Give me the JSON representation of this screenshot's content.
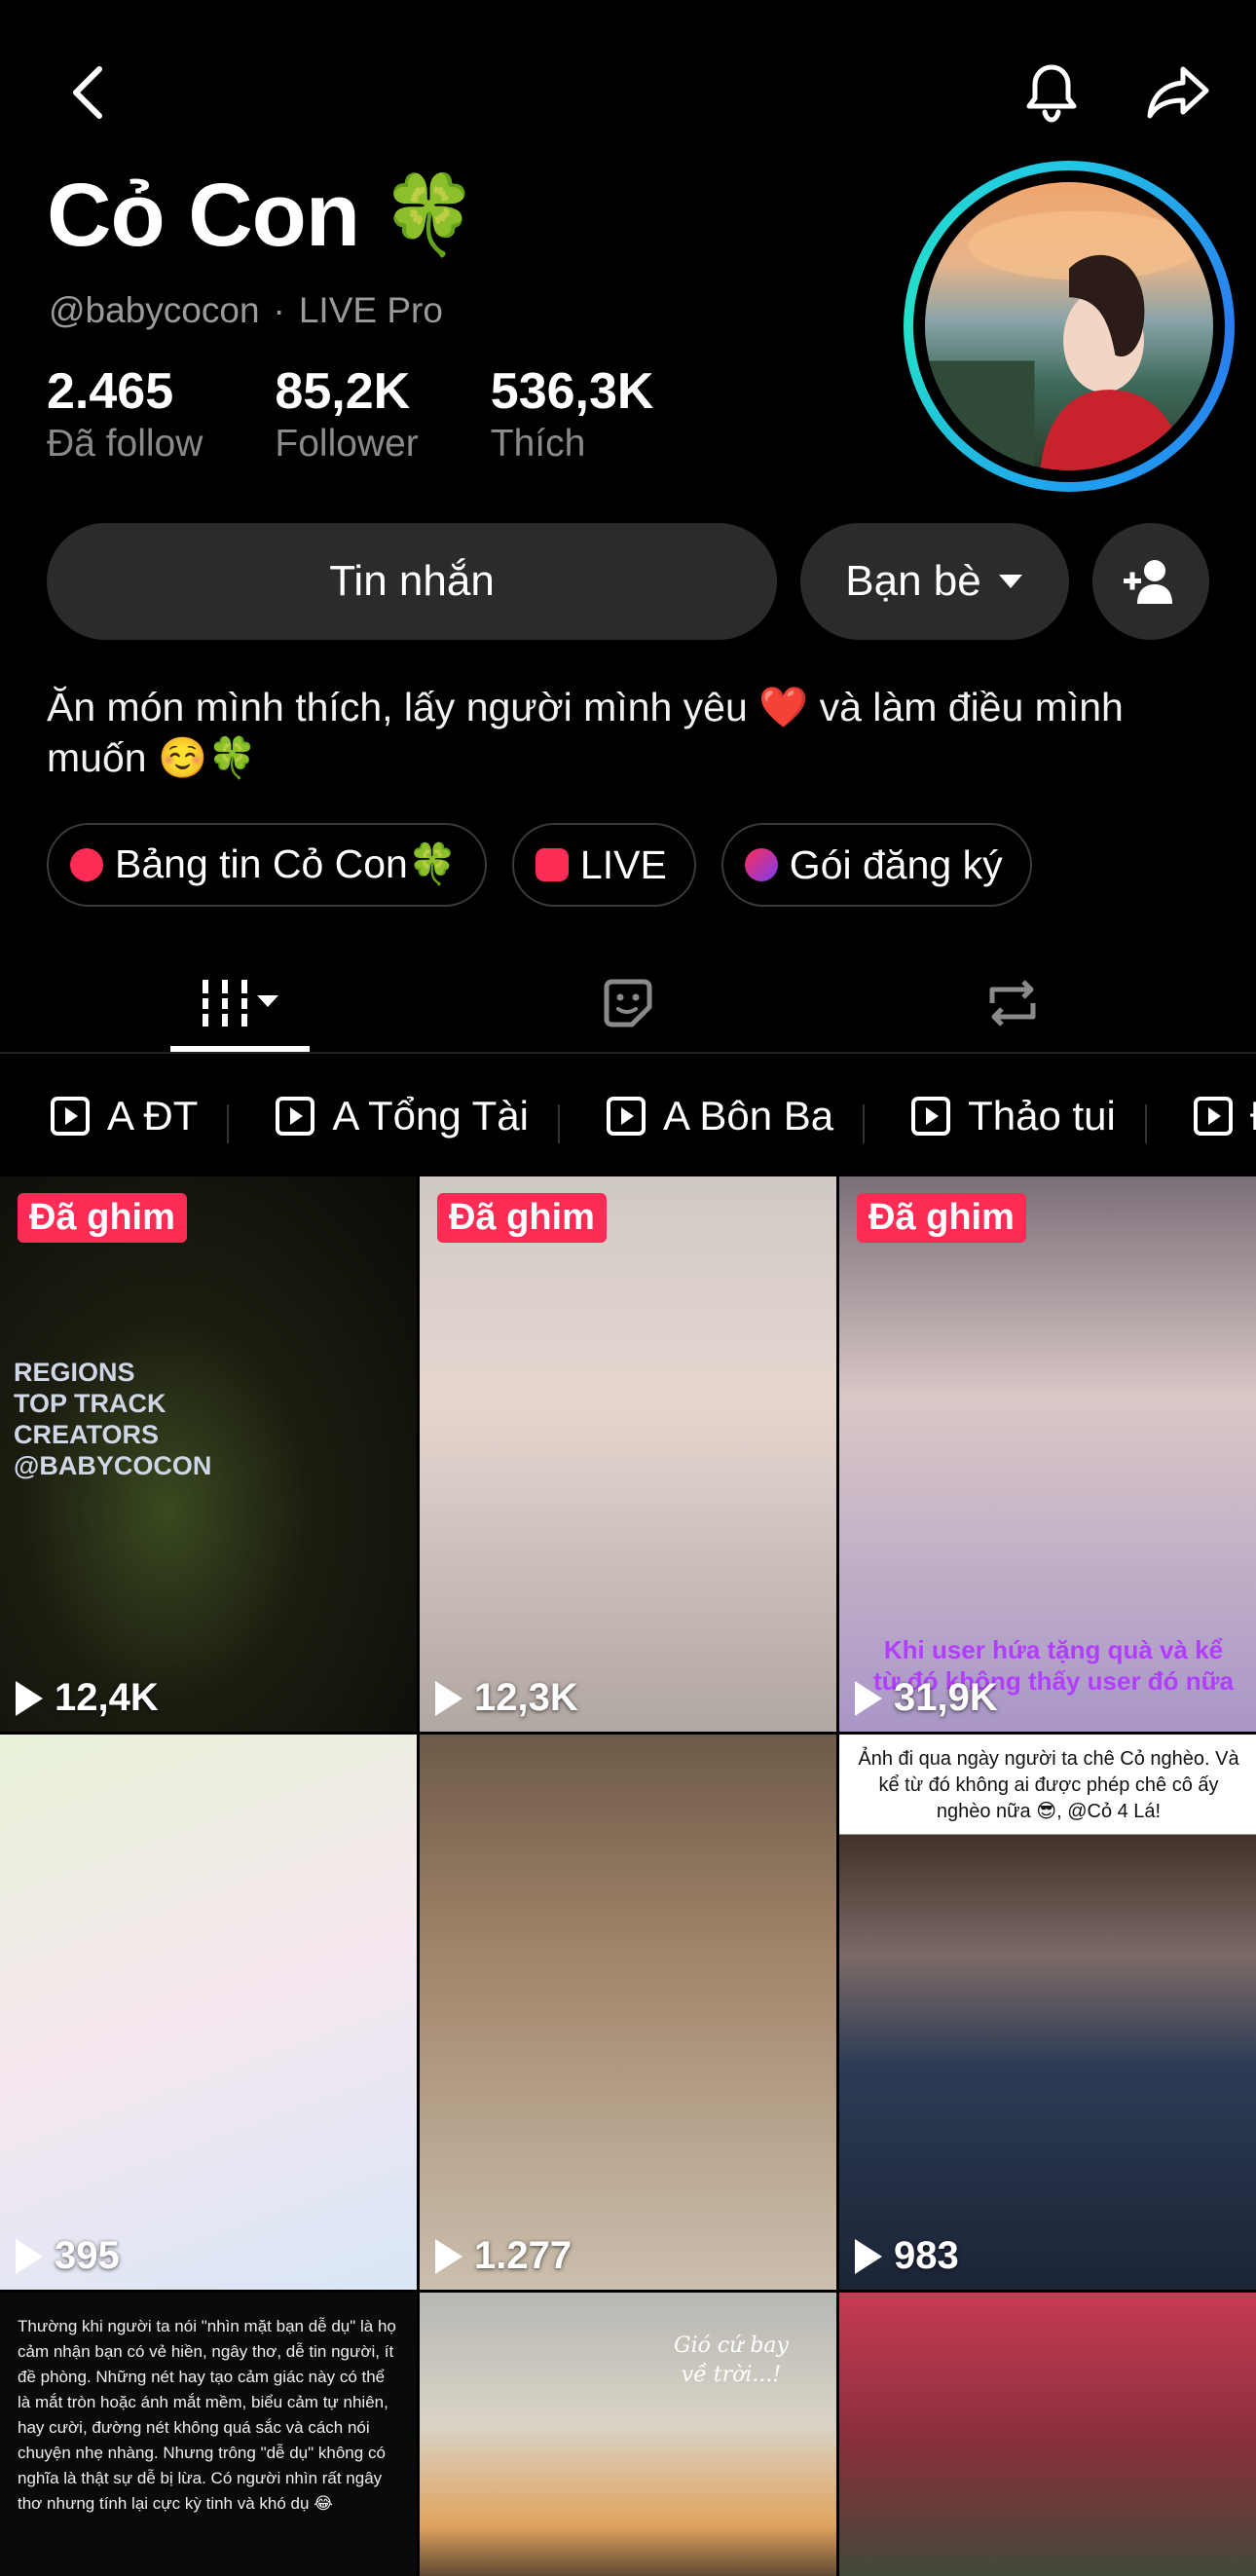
{
  "profile": {
    "name": "Cỏ Con",
    "clover": "🍀",
    "handle": "@babycocon",
    "separator": "·",
    "badge": "LIVE Pro"
  },
  "stats": [
    {
      "value": "2.465",
      "label": "Đã follow"
    },
    {
      "value": "85,2K",
      "label": "Follower"
    },
    {
      "value": "536,3K",
      "label": "Thích"
    }
  ],
  "actions": {
    "message_label": "Tin nhắn",
    "friends_label": "Bạn bè"
  },
  "bio": "Ăn món mình thích, lấy người mình yêu ❤️ và làm điều mình muốn ☺️🍀",
  "chips": [
    {
      "label": "Bảng tin Cỏ Con🍀",
      "color": "#fe2c55"
    },
    {
      "label": "LIVE",
      "color": "#fe2c55"
    },
    {
      "label": "Gói đăng ký",
      "color": "#fe2c55"
    }
  ],
  "playlists": [
    "A ĐT",
    "A Tổng Tài",
    "A Bôn Ba",
    "Thảo tui",
    "Đ"
  ],
  "videos": [
    {
      "pinned": "Đã ghim",
      "views": "12,4K",
      "overlay": "REGIONS TOP TRACK CREATORS @babycocon"
    },
    {
      "pinned": "Đã ghim",
      "views": "12,3K",
      "overlay": ""
    },
    {
      "pinned": "Đã ghim",
      "views": "31,9K",
      "overlay": "Khi user hứa tặng quà và kể từ đó không thấy user đó nữa"
    },
    {
      "pinned": "",
      "views": "395",
      "overlay": ""
    },
    {
      "pinned": "",
      "views": "1.277",
      "overlay": ""
    },
    {
      "pinned": "",
      "views": "983",
      "overlay": "Ảnh đi qua ngày người ta chê Cỏ nghèo. Và kể từ đó không ai được phép chê cô ấy nghèo nữa 😎, @Cỏ 4 Lá!"
    },
    {
      "pinned": "",
      "views": "",
      "overlay": "Thường khi người ta nói \"nhìn mặt bạn dễ dụ\" là họ cảm nhận bạn có vẻ hiền, ngây thơ, dễ tin người, ít đề phòng. Những nét hay tạo cảm giác này có thể là mắt tròn hoặc ánh mắt mềm, biểu cảm tự nhiên, hay cười, đường nét không quá sắc và cách nói chuyện nhẹ nhàng. Nhưng trông \"dễ dụ\" không có nghĩa là thật sự dễ bị lừa. Có người nhìn rất ngây thơ nhưng tính lại cực kỳ tinh và khó dụ 😂"
    },
    {
      "pinned": "",
      "views": "",
      "overlay": "Gió cứ bay về trời...!"
    },
    {
      "pinned": "",
      "views": "",
      "overlay": ""
    }
  ]
}
